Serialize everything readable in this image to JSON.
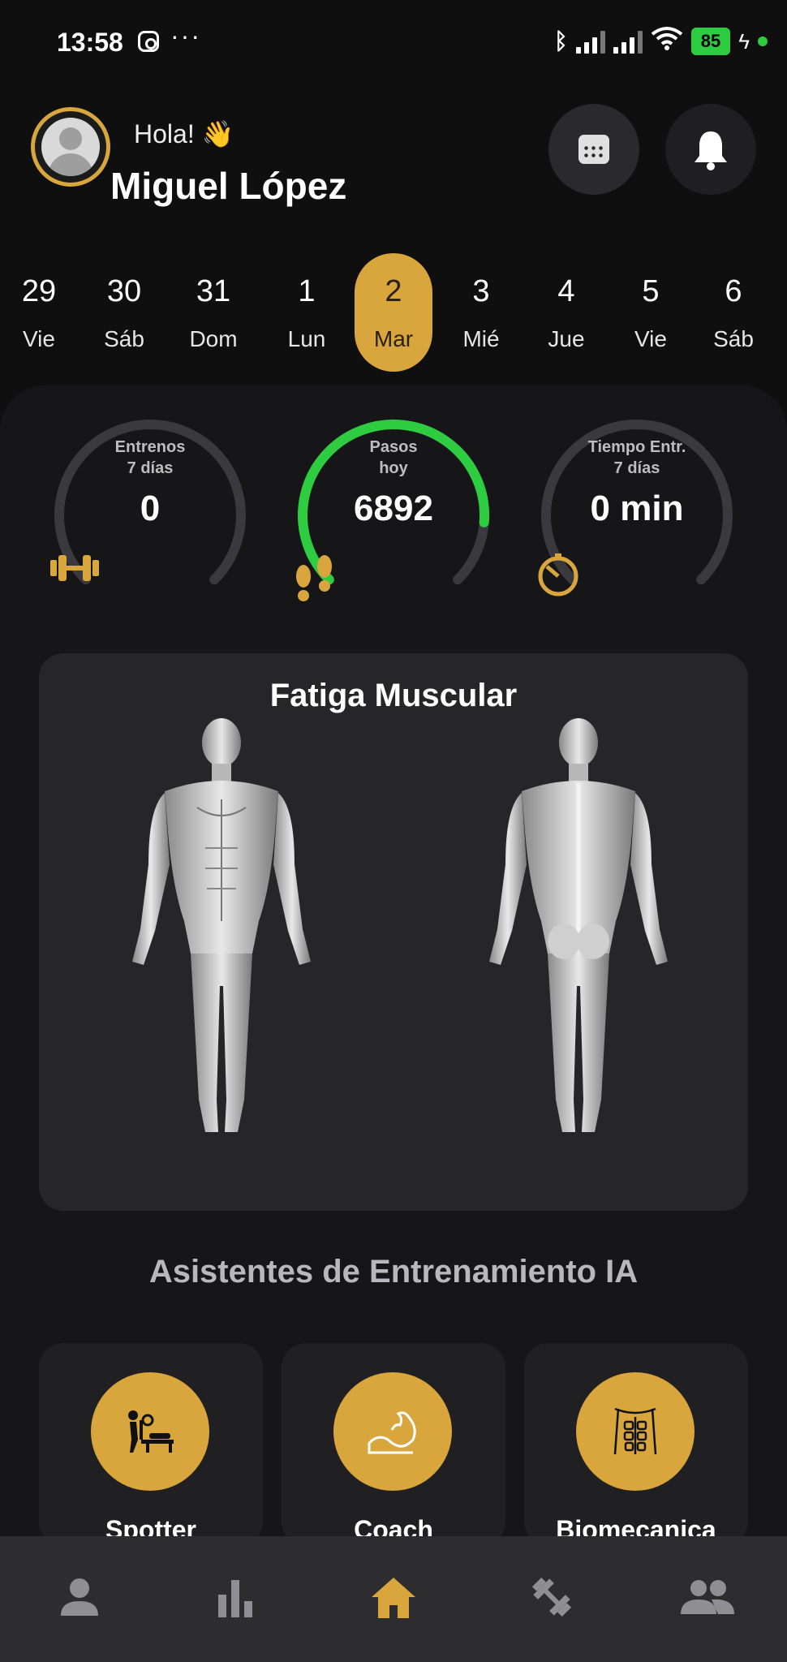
{
  "status_bar": {
    "time": "13:58",
    "battery": "85",
    "icons": [
      "instagram-icon",
      "more-dots-icon",
      "bluetooth-icon",
      "signal-icon",
      "signal-icon",
      "wifi-icon",
      "battery-icon",
      "charging-icon"
    ]
  },
  "header": {
    "greeting": "Hola! 👋",
    "user_name": "Miguel López",
    "actions": [
      "calendar-icon",
      "bell-icon"
    ]
  },
  "dates": [
    {
      "num": "29",
      "day": "Vie"
    },
    {
      "num": "30",
      "day": "Sáb"
    },
    {
      "num": "31",
      "day": "Dom"
    },
    {
      "num": "1",
      "day": "Lun"
    },
    {
      "num": "2",
      "day": "Mar",
      "selected": true
    },
    {
      "num": "3",
      "day": "Mié"
    },
    {
      "num": "4",
      "day": "Jue"
    },
    {
      "num": "5",
      "day": "Vie"
    },
    {
      "num": "6",
      "day": "Sáb"
    }
  ],
  "stats": [
    {
      "label_line1": "Entrenos",
      "label_line2": "7 días",
      "value": "0",
      "progress": 0,
      "icon": "dumbbell-icon"
    },
    {
      "label_line1": "Pasos",
      "label_line2": "hoy",
      "value": "6892",
      "progress": 0.85,
      "icon": "footprints-icon"
    },
    {
      "label_line1": "Tiempo Entr.",
      "label_line2": "7 días",
      "value": "0 min",
      "progress": 0,
      "icon": "timer-icon"
    }
  ],
  "muscle_card": {
    "title": "Fatiga Muscular"
  },
  "ai_section": {
    "title": "Asistentes de Entrenamiento IA",
    "cards": [
      {
        "label": "Spotter",
        "icon": "bench-press-icon"
      },
      {
        "label": "Coach",
        "icon": "flexed-arm-icon"
      },
      {
        "label": "Biomecanica",
        "icon": "abs-icon"
      }
    ]
  },
  "bottom_nav": {
    "items": [
      "profile-icon",
      "stats-icon",
      "home-icon",
      "workout-icon",
      "community-icon"
    ],
    "active": "home-icon"
  },
  "colors": {
    "accent": "#d8a63c",
    "steps_ring": "#2ecc40",
    "background": "#0f0f10",
    "card": "#262628"
  }
}
